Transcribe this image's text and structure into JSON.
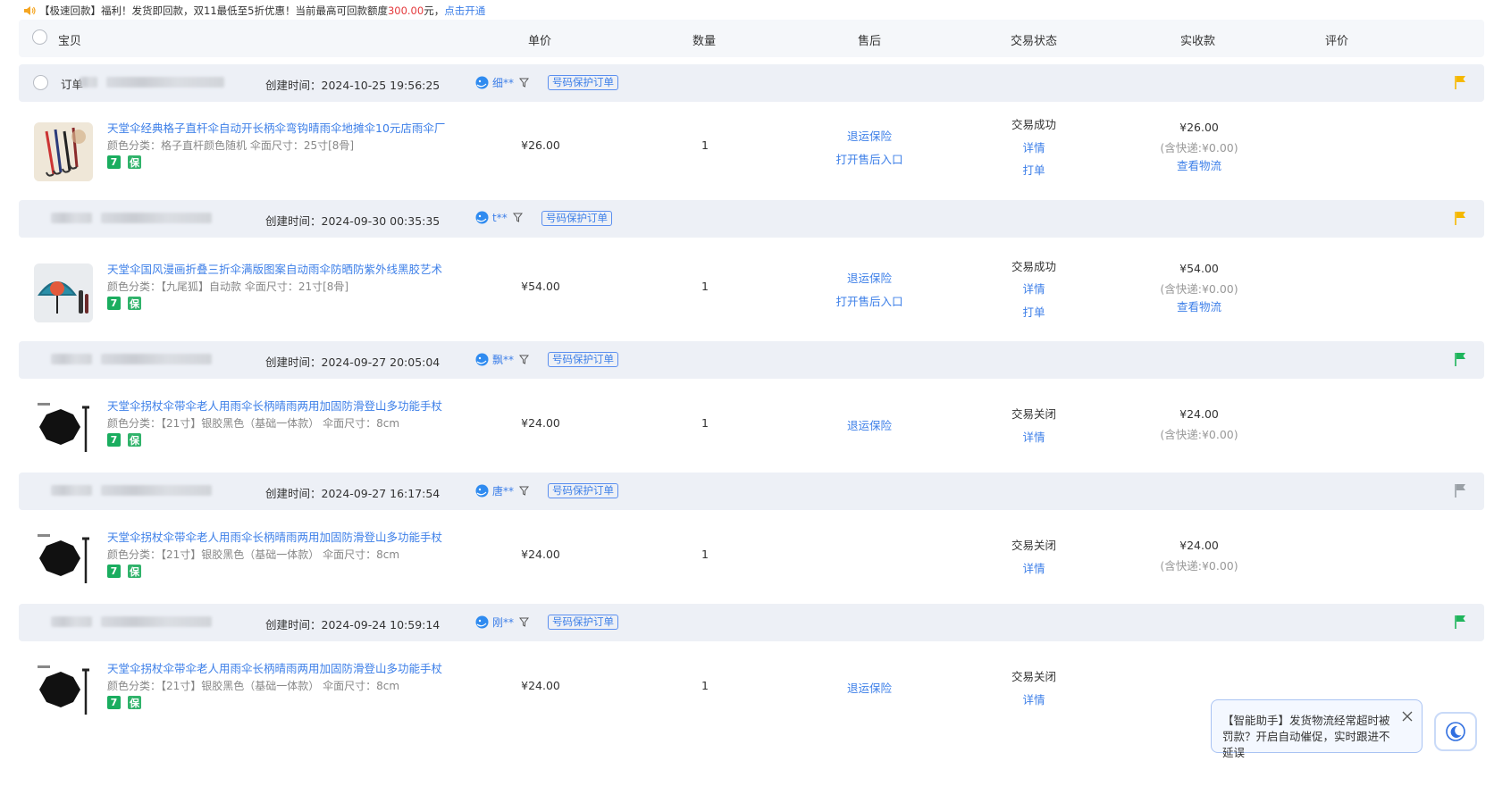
{
  "notice": {
    "text_before": "【极速回款】福利！发货即回款，双11最低至5折优惠！当前最高可回款额度",
    "amount": "300.00",
    "text_after": "元，",
    "link": "点击开通"
  },
  "columns": {
    "item": "宝贝",
    "unit_price": "单价",
    "quantity": "数量",
    "after_sales": "售后",
    "trade_status": "交易状态",
    "received": "实收款",
    "review": "评价"
  },
  "colors": {
    "link": "#3d7fe8",
    "amount_red": "#e4393c",
    "flag_yellow": "#f5b800",
    "flag_green": "#1fb55c",
    "flag_gray": "#9aa0a6"
  },
  "orders": [
    {
      "order_label": "订单",
      "created": "创建时间：2024-10-25 19:56:25",
      "buyer": "细**",
      "protect": "号码保护订单",
      "flag": "yellow",
      "title": "天堂伞经典格子直杆伞自动开长柄伞弯钩晴雨伞地摊伞10元店雨伞厂",
      "sku": "颜色分类：格子直杆颜色随机  伞面尺寸：25寸[8骨]",
      "badges": [
        "7",
        "保"
      ],
      "price": "¥26.00",
      "qty": "1",
      "after_sales": [
        "退运保险",
        "打开售后入口"
      ],
      "status": "交易成功",
      "status_links": [
        "详情",
        "打单"
      ],
      "received": "¥26.00",
      "shipping": "(含快递:¥0.00)",
      "logistics": "查看物流"
    },
    {
      "order_label": "",
      "created": "创建时间：2024-09-30 00:35:35",
      "buyer": "t**",
      "protect": "号码保护订单",
      "flag": "yellow",
      "title": "天堂伞国风漫画折叠三折伞满版图案自动雨伞防晒防紫外线黑胶艺术",
      "sku": "颜色分类：【九尾狐】自动款  伞面尺寸：21寸[8骨]",
      "badges": [
        "7",
        "保"
      ],
      "price": "¥54.00",
      "qty": "1",
      "after_sales": [
        "退运保险",
        "打开售后入口"
      ],
      "status": "交易成功",
      "status_links": [
        "详情",
        "打单"
      ],
      "received": "¥54.00",
      "shipping": "(含快递:¥0.00)",
      "logistics": "查看物流"
    },
    {
      "order_label": "",
      "created": "创建时间：2024-09-27 20:05:04",
      "buyer": "飘**",
      "protect": "号码保护订单",
      "flag": "green",
      "title": "天堂伞拐杖伞带伞老人用雨伞长柄晴雨两用加固防滑登山多功能手杖",
      "sku": "颜色分类：【21寸】银胶黑色（基础一体款）  伞面尺寸：8cm",
      "badges": [
        "7",
        "保"
      ],
      "price": "¥24.00",
      "qty": "1",
      "after_sales": [
        "退运保险"
      ],
      "status": "交易关闭",
      "status_links": [
        "详情"
      ],
      "received": "¥24.00",
      "shipping": "(含快递:¥0.00)",
      "logistics": ""
    },
    {
      "order_label": "",
      "created": "创建时间：2024-09-27 16:17:54",
      "buyer": "唐**",
      "protect": "号码保护订单",
      "flag": "gray",
      "title": "天堂伞拐杖伞带伞老人用雨伞长柄晴雨两用加固防滑登山多功能手杖",
      "sku": "颜色分类：【21寸】银胶黑色（基础一体款）  伞面尺寸：8cm",
      "badges": [
        "7",
        "保"
      ],
      "price": "¥24.00",
      "qty": "1",
      "after_sales": [],
      "status": "交易关闭",
      "status_links": [
        "详情"
      ],
      "received": "¥24.00",
      "shipping": "(含快递:¥0.00)",
      "logistics": ""
    },
    {
      "order_label": "",
      "created": "创建时间：2024-09-24 10:59:14",
      "buyer": "刚**",
      "protect": "号码保护订单",
      "flag": "green",
      "title": "天堂伞拐杖伞带伞老人用雨伞长柄晴雨两用加固防滑登山多功能手杖",
      "sku": "颜色分类：【21寸】银胶黑色（基础一体款）  伞面尺寸：8cm",
      "badges": [
        "7",
        "保"
      ],
      "price": "¥24.00",
      "qty": "1",
      "after_sales": [
        "退运保险"
      ],
      "status": "交易关闭",
      "status_links": [
        "详情"
      ],
      "received": "",
      "shipping": "",
      "logistics": ""
    }
  ],
  "assistant": {
    "text": "【智能助手】发货物流经常超时被罚款？开启自动催促，实时跟进不延误"
  }
}
